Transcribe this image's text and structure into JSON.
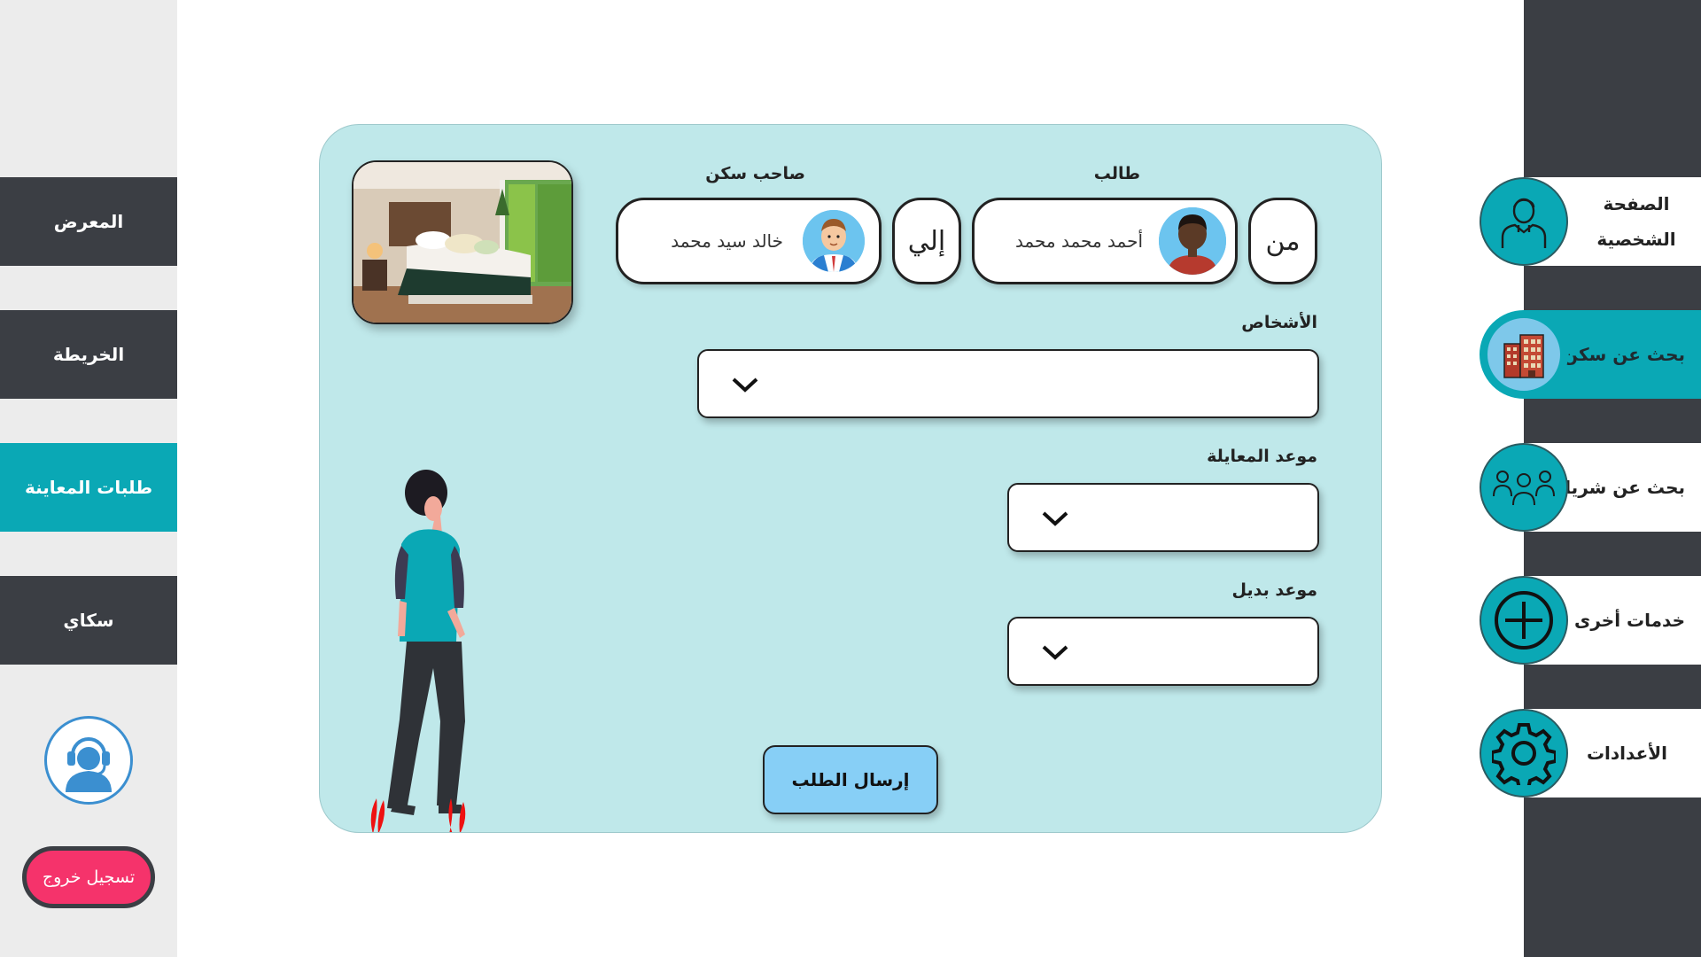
{
  "left_nav": {
    "items": [
      {
        "label": "المعرض"
      },
      {
        "label": "الخريطة"
      },
      {
        "label": "طلبات المعاينة"
      },
      {
        "label": "سكاي"
      }
    ],
    "logout_label": "تسجيل خروج"
  },
  "right_nav": {
    "items": [
      {
        "label": "الصفحة الشخصية",
        "icon": "user-icon"
      },
      {
        "label": "بحث عن سكن",
        "icon": "building-icon"
      },
      {
        "label": "بحث عن شريك",
        "icon": "group-icon"
      },
      {
        "label": "خدمات أخرى",
        "icon": "plus-circle-icon"
      },
      {
        "label": "الأعدادات",
        "icon": "gear-icon"
      }
    ]
  },
  "form": {
    "from_label": "من",
    "to_label": "إلي",
    "requester_title": "طالب",
    "requester_name": "أحمد محمد محمد",
    "owner_title": "صاحب سكن",
    "owner_name": "خالد سيد محمد",
    "persons_label": "الأشخاص",
    "inspection_date_label": "موعد المعايلة",
    "alternative_date_label": "موعد بديل",
    "submit_label": "إرسال الطلب"
  },
  "colors": {
    "accent": "#0aa8b5",
    "dark": "#3b3e44",
    "card_bg": "#bfe8ea",
    "logout": "#f5336b",
    "submit": "#87cff6"
  }
}
